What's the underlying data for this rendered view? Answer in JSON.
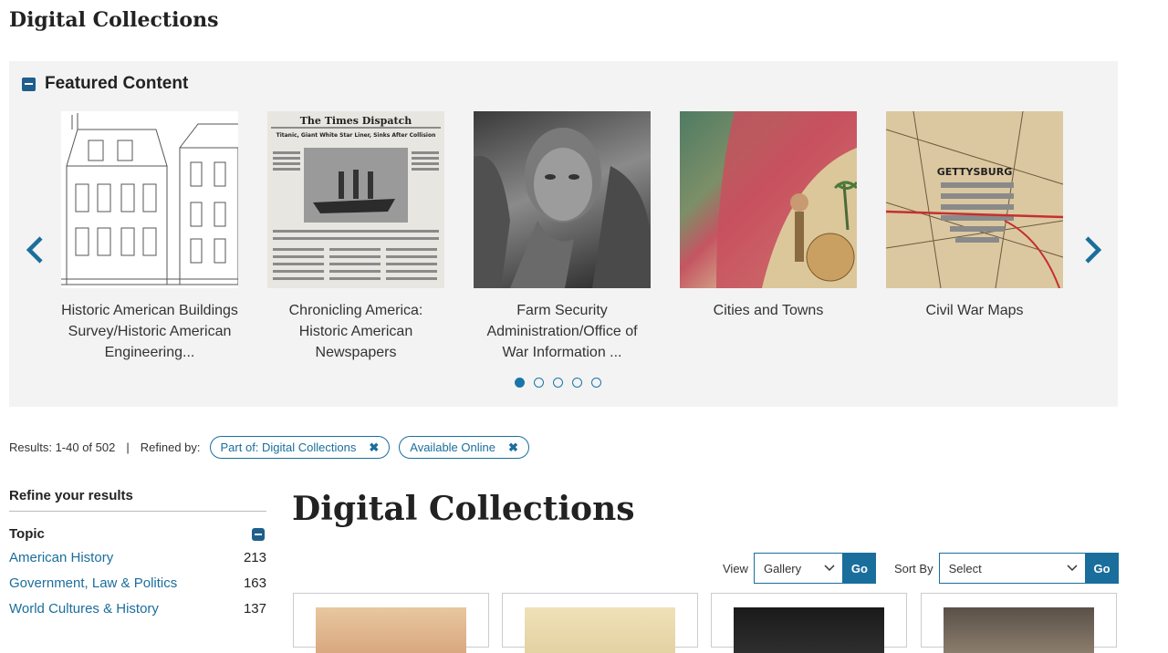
{
  "page": {
    "title": "Digital Collections"
  },
  "featured": {
    "title": "Featured Content",
    "slides": [
      {
        "caption": "Historic American Buildings Survey/Historic American Engineering..."
      },
      {
        "caption": "Chronicling America: Historic American Newspapers"
      },
      {
        "caption": "Farm Security Administration/Office of War Information ..."
      },
      {
        "caption": "Cities and Towns"
      },
      {
        "caption": "Civil War Maps"
      }
    ],
    "newspaper_masthead": "The Times Dispatch",
    "newspaper_headline": "Titanic, Giant White Star Liner, Sinks After Collision",
    "map_label": "GETTYSBURG"
  },
  "results": {
    "summary": "Results: 1-40 of 502",
    "separator": "|",
    "refined_by": "Refined by:",
    "chips": [
      {
        "label": "Part of: Digital Collections",
        "remove": "✖"
      },
      {
        "label": "Available Online",
        "remove": "✖"
      }
    ]
  },
  "refine": {
    "title": "Refine your results",
    "facet_title": "Topic",
    "items": [
      {
        "label": "American History",
        "count": "213"
      },
      {
        "label": "Government, Law & Politics",
        "count": "163"
      },
      {
        "label": "World Cultures & History",
        "count": "137"
      }
    ]
  },
  "main": {
    "title": "Digital Collections"
  },
  "controls": {
    "view_label": "View",
    "view_value": "Gallery",
    "sort_label": "Sort By",
    "sort_value": "Select",
    "go_label": "Go"
  },
  "colors": {
    "accent": "#1a6e9c",
    "panel": "#f3f3f3"
  }
}
